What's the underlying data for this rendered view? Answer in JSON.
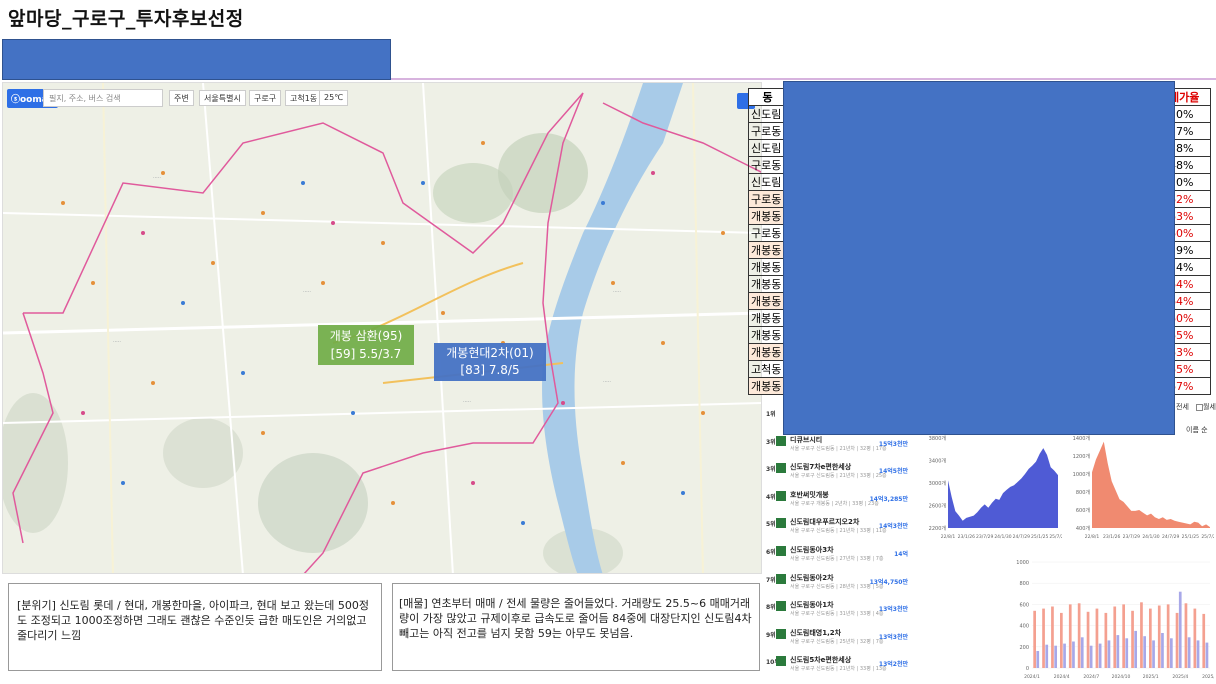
{
  "page": {
    "title": "앞마당_구로구_투자후보선정"
  },
  "map": {
    "logo": "ⓢoomap",
    "search_placeholder": "필지, 주소, 버스 검색",
    "toolbar": [
      "주변",
      "서울특별시",
      "구로구",
      "고척1동",
      "25℃"
    ],
    "label_green": {
      "line1": "개봉 삼환(95)",
      "line2": "[59] 5.5/3.7"
    },
    "label_blue": {
      "line1": "개봉현대2차(01)",
      "line2": "[83] 7.8/5"
    },
    "colors": {
      "green": "#70AD47",
      "blue": "#4472C4",
      "boundary": "#e05a9c",
      "river": "#a8cbe8"
    }
  },
  "table": {
    "header": {
      "dong": "동",
      "jeonse_rate": "세가율"
    },
    "rows": [
      {
        "dong": "신도림",
        "pct": "50%",
        "red": false,
        "orange": false
      },
      {
        "dong": "구로동",
        "pct": "57%",
        "red": false,
        "orange": false
      },
      {
        "dong": "신도림",
        "pct": "58%",
        "red": false,
        "orange": false
      },
      {
        "dong": "구로동",
        "pct": "48%",
        "red": false,
        "orange": false
      },
      {
        "dong": "신도림",
        "pct": "50%",
        "red": false,
        "orange": false
      },
      {
        "dong": "구로동",
        "pct": "62%",
        "red": true,
        "orange": true
      },
      {
        "dong": "개봉동",
        "pct": "63%",
        "red": true,
        "orange": true
      },
      {
        "dong": "구로동",
        "pct": "60%",
        "red": true,
        "orange": false
      },
      {
        "dong": "개봉동",
        "pct": "59%",
        "red": false,
        "orange": true
      },
      {
        "dong": "개봉동",
        "pct": "54%",
        "red": false,
        "orange": false
      },
      {
        "dong": "개봉동",
        "pct": "64%",
        "red": true,
        "orange": false
      },
      {
        "dong": "개봉동",
        "pct": "64%",
        "red": true,
        "orange": true
      },
      {
        "dong": "개봉동",
        "pct": "60%",
        "red": true,
        "orange": false
      },
      {
        "dong": "개봉동",
        "pct": "65%",
        "red": true,
        "orange": false
      },
      {
        "dong": "개봉동",
        "pct": "63%",
        "red": true,
        "orange": true
      },
      {
        "dong": "고척동",
        "pct": "65%",
        "red": true,
        "orange": false
      },
      {
        "dong": "개봉동",
        "pct": "67%",
        "red": true,
        "orange": true
      }
    ]
  },
  "filters": {
    "jeonse": "전세",
    "monthly": "월세",
    "sort": "이름 순"
  },
  "ranking": [
    {
      "num": "1위",
      "name": "",
      "price": ""
    },
    {
      "num": "3위",
      "name": "디큐브시티",
      "sub": "서울 구로구 신도림동 | 21년차 | 32평 | 17층",
      "price": "15억3천만"
    },
    {
      "num": "3위",
      "name": "신도림7차e편한세상",
      "sub": "서울 구로구 신도림동 | 21년차 | 33평 | 25층",
      "price": "14억5천만"
    },
    {
      "num": "4위",
      "name": "호반써밋개봉",
      "sub": "서울 구로구 개봉동 | 2년차 | 33평 | 23층",
      "price": "14억3,285만"
    },
    {
      "num": "5위",
      "name": "신도림대우푸르지오2차",
      "sub": "서울 구로구 신도림동 | 21년차 | 33평 | 11층",
      "price": "14억3천만"
    },
    {
      "num": "6위",
      "name": "신도림동아3차",
      "sub": "서울 구로구 신도림동 | 27년차 | 33평 | 7층",
      "price": "14억"
    },
    {
      "num": "7위",
      "name": "신도림동아2차",
      "sub": "서울 구로구 신도림동 | 28년차 | 33평 | 5층",
      "price": "13억4,750만"
    },
    {
      "num": "8위",
      "name": "신도림동아1차",
      "sub": "서울 구로구 신도림동 | 31년차 | 33평 | 4층",
      "price": "13억3천만"
    },
    {
      "num": "9위",
      "name": "신도림태영1,2차",
      "sub": "서울 구로구 신도림동 | 25년차 | 32평 | 7층",
      "price": "13억3천만"
    },
    {
      "num": "10위",
      "name": "신도림5차e편한세상",
      "sub": "서울 구로구 신도림동 | 21년차 | 33평 | 13층",
      "price": "13억2천만"
    }
  ],
  "chart_data": [
    {
      "type": "area",
      "y_ticks": [
        "2200개",
        "2600개",
        "3000개",
        "3400개",
        "3800개"
      ],
      "ylim": [
        2200,
        3800
      ],
      "x_ticks": [
        "22/8/1",
        "23/1/26",
        "23/7/29",
        "24/1/30",
        "24/7/29",
        "25/1/25",
        "25/7/24"
      ],
      "color": "#4f5bd5",
      "values": [
        3050,
        2750,
        2500,
        2420,
        2330,
        2380,
        2400,
        2420,
        2480,
        2560,
        2620,
        2560,
        2650,
        2720,
        2700,
        2820,
        2880,
        2930,
        2960,
        3020,
        3080,
        3160,
        3250,
        3310,
        3380,
        3520,
        3620,
        3500,
        3280,
        3220,
        3140
      ]
    },
    {
      "type": "area",
      "y_ticks": [
        "400개",
        "600개",
        "800개",
        "1000개",
        "1200개",
        "1400개"
      ],
      "ylim": [
        400,
        1400
      ],
      "x_ticks": [
        "22/8/1",
        "23/1/26",
        "23/7/29",
        "24/1/30",
        "24/7/29",
        "25/1/25",
        "25/7/24"
      ],
      "color": "#f08a70",
      "values": [
        1020,
        1160,
        1260,
        1360,
        1120,
        920,
        820,
        720,
        690,
        640,
        590,
        590,
        600,
        570,
        540,
        560,
        520,
        500,
        520,
        490,
        500,
        480,
        470,
        460,
        450,
        440,
        470,
        460,
        420,
        440,
        410
      ]
    },
    {
      "type": "bar",
      "y_ticks": [
        "0",
        "200",
        "400",
        "600",
        "800",
        "1000"
      ],
      "ylim": [
        0,
        1000
      ],
      "x_ticks": [
        "2024/1",
        "2024/4",
        "2024/7",
        "2024/10",
        "2025/1",
        "2025/4",
        "2025/7"
      ],
      "series": [
        {
          "color": "#f4a090",
          "values": [
            540,
            560,
            580,
            520,
            600,
            610,
            530,
            560,
            520,
            580,
            600,
            540,
            620,
            560,
            590,
            600,
            520,
            610,
            560,
            510
          ]
        },
        {
          "color": "#a8a8e8",
          "values": [
            160,
            220,
            210,
            230,
            250,
            290,
            210,
            230,
            260,
            310,
            280,
            350,
            300,
            260,
            330,
            280,
            720,
            290,
            260,
            240
          ]
        }
      ]
    }
  ]
}
